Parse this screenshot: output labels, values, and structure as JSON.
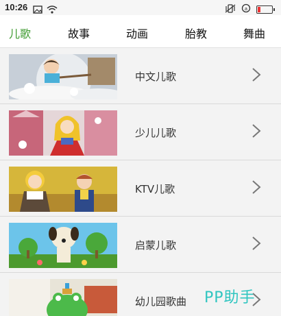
{
  "status": {
    "time": "10:26"
  },
  "tabs": [
    {
      "label": "儿歌",
      "active": true
    },
    {
      "label": "故事",
      "active": false
    },
    {
      "label": "动画",
      "active": false
    },
    {
      "label": "胎教",
      "active": false
    },
    {
      "label": "舞曲",
      "active": false
    }
  ],
  "items": [
    {
      "label": "中文儿歌"
    },
    {
      "label": "少儿儿歌"
    },
    {
      "label": "KTV儿歌"
    },
    {
      "label": "启蒙儿歌"
    },
    {
      "label": "幼儿园歌曲"
    }
  ],
  "watermark": "PP助手",
  "colors": {
    "accent": "#3c9a2e",
    "watermark": "#2fc5c0"
  }
}
